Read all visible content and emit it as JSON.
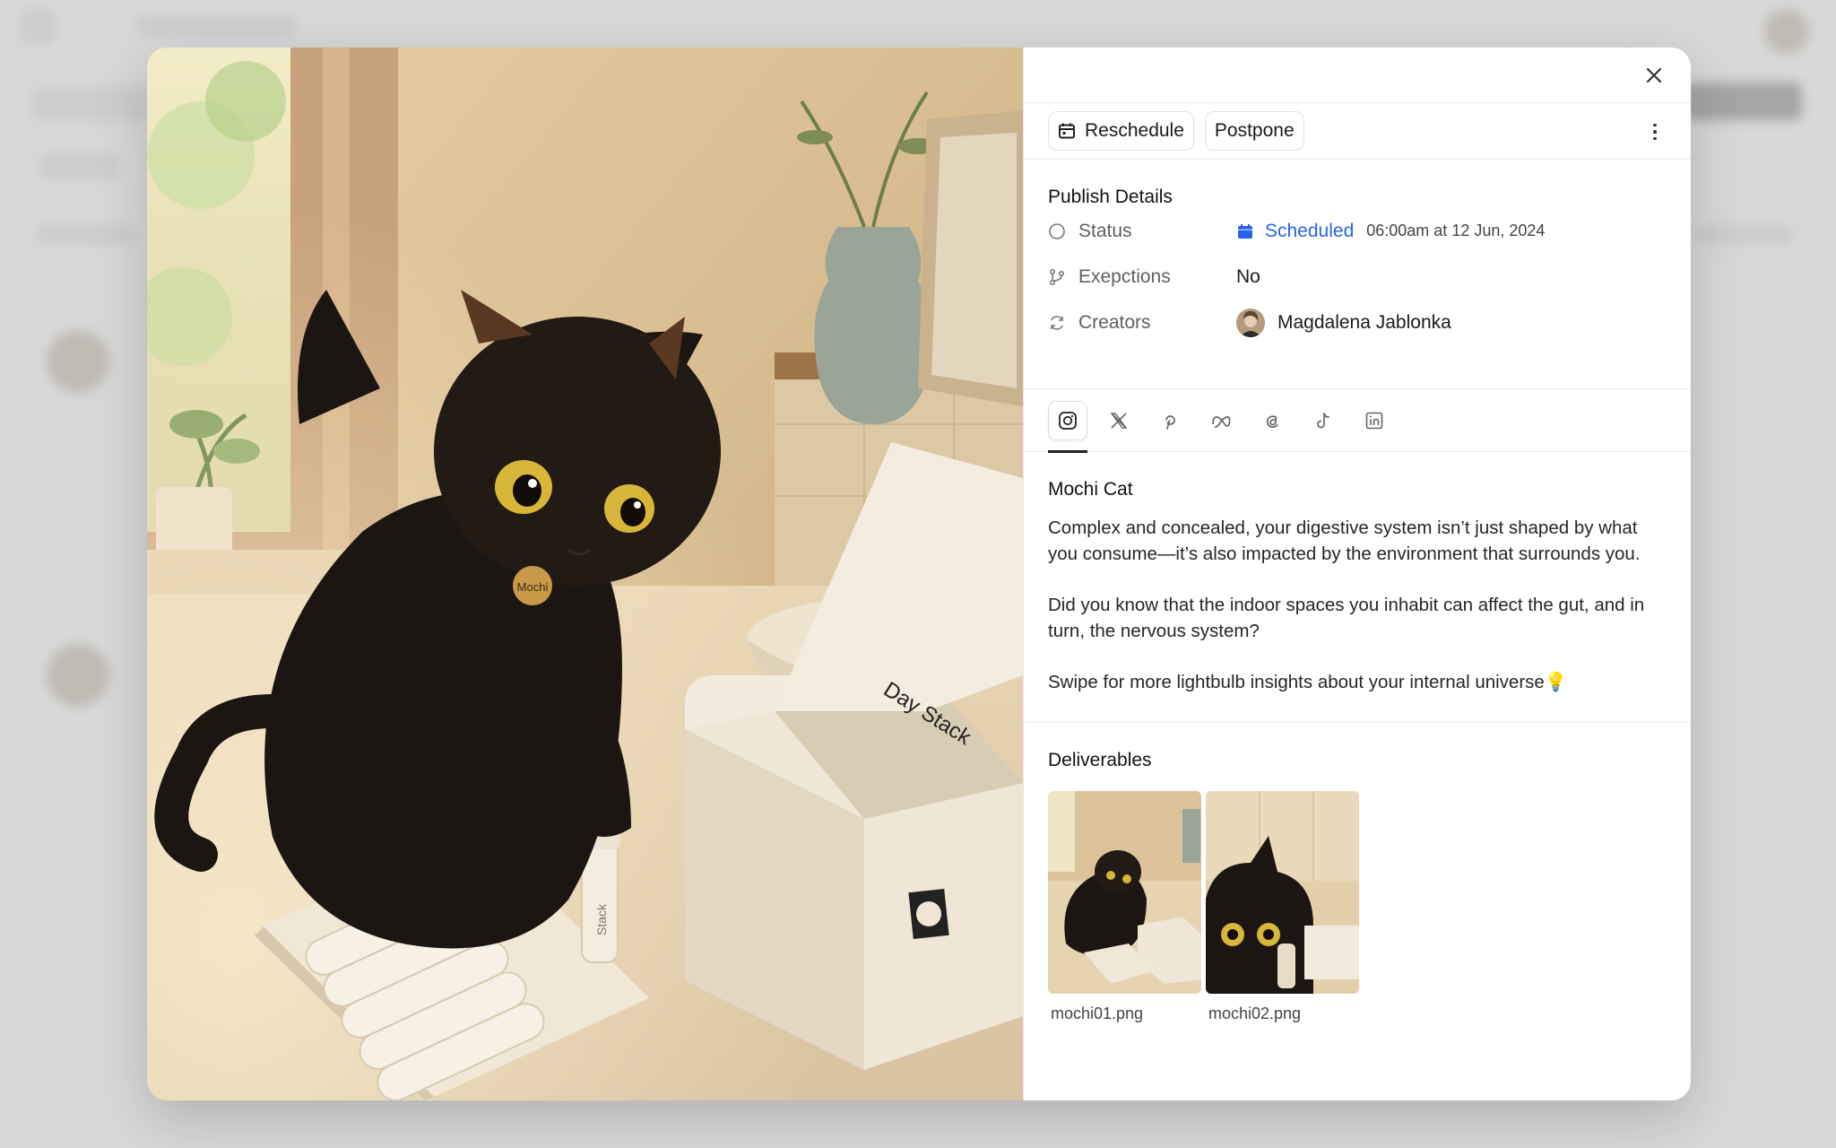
{
  "modal": {
    "close_icon": "close-icon",
    "actions": {
      "reschedule_label": "Reschedule",
      "postpone_label": "Postpone",
      "more_icon": "more-vertical-icon"
    },
    "publish_details": {
      "title": "Publish Details",
      "status_label": "Status",
      "status_value": "Scheduled",
      "status_time": "06:00am at 12 Jun, 2024",
      "status_color": "#2563eb",
      "exceptions_label": "Exepctions",
      "exceptions_value": "No",
      "creators_label": "Creators",
      "creator_name": "Magdalena Jablonka"
    },
    "platform_tabs": [
      {
        "icon": "instagram-icon",
        "active": true
      },
      {
        "icon": "x-icon",
        "active": false
      },
      {
        "icon": "pinterest-icon",
        "active": false
      },
      {
        "icon": "meta-icon",
        "active": false
      },
      {
        "icon": "threads-icon",
        "active": false
      },
      {
        "icon": "tiktok-icon",
        "active": false
      },
      {
        "icon": "linkedin-icon",
        "active": false
      }
    ],
    "post": {
      "title": "Mochi Cat",
      "paragraphs": [
        "Complex and concealed, your digestive system isn’t just shaped by what you consume—it’s also impacted by the environment that surrounds you.",
        "Did you know that the indoor spaces you inhabit can affect the gut, and in turn, the nervous system?",
        "Swipe for more lightbulb insights about your internal universe💡"
      ]
    },
    "deliverables": {
      "title": "Deliverables",
      "files": [
        "mochi01.png",
        "mochi02.png"
      ]
    },
    "media": {
      "collar_tag": "Mochi",
      "box_brand": "Day Stack",
      "vial_label": "Stack"
    }
  }
}
